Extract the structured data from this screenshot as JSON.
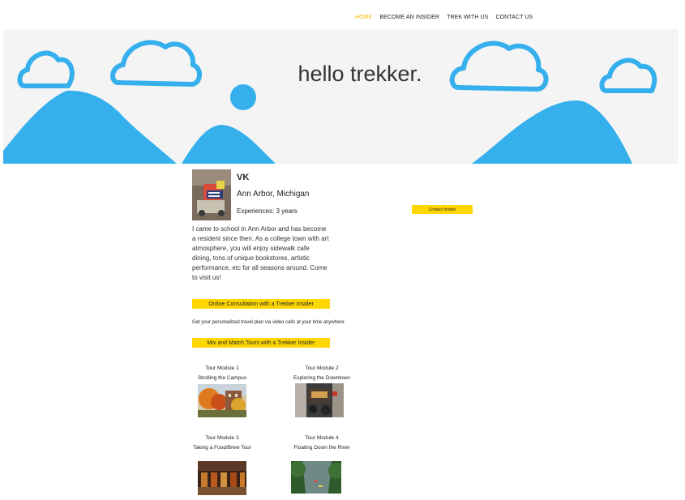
{
  "nav": {
    "items": [
      "HOME",
      "BECOME AN INSIDER",
      "TREK WITH US",
      "CONTACT US"
    ],
    "active_index": 0
  },
  "hero": {
    "title": "hello trekker."
  },
  "profile": {
    "name": "VK",
    "location": "Ann Arbor, Michigan",
    "experience": "Experiences: 3 years",
    "bio": "I came to school in Ann Arbor and has become a resident since then. As a college town with art atmosphere, you will enjoy sidewalk cafe dining, tons of unique bookstores, artistic performance, etc for all seasons around. Come to visit us!"
  },
  "buttons": {
    "contact": "Contact Insider",
    "consultation": "Online Consultation with a Trekker Insider",
    "mix_match": "Mix and Match Tours with a Trekker Insider"
  },
  "consultation_desc": "Get your personalized travel plan via video calls at your time anywhere",
  "tours": [
    {
      "module": "Tour Module 1",
      "title": "Strolling the Campus"
    },
    {
      "module": "Tour Module 2",
      "title": "Exploring the Downtown"
    },
    {
      "module": "Tour Module 3",
      "title": "Taking a Food/Brew Tour"
    },
    {
      "module": "Tour Module 4",
      "title": "Floating Down the River"
    }
  ],
  "colors": {
    "accent": "#ffd700",
    "nav_active": "#f5b800",
    "hero_blue": "#35b0ec",
    "hero_bg": "#f4f4f4"
  }
}
